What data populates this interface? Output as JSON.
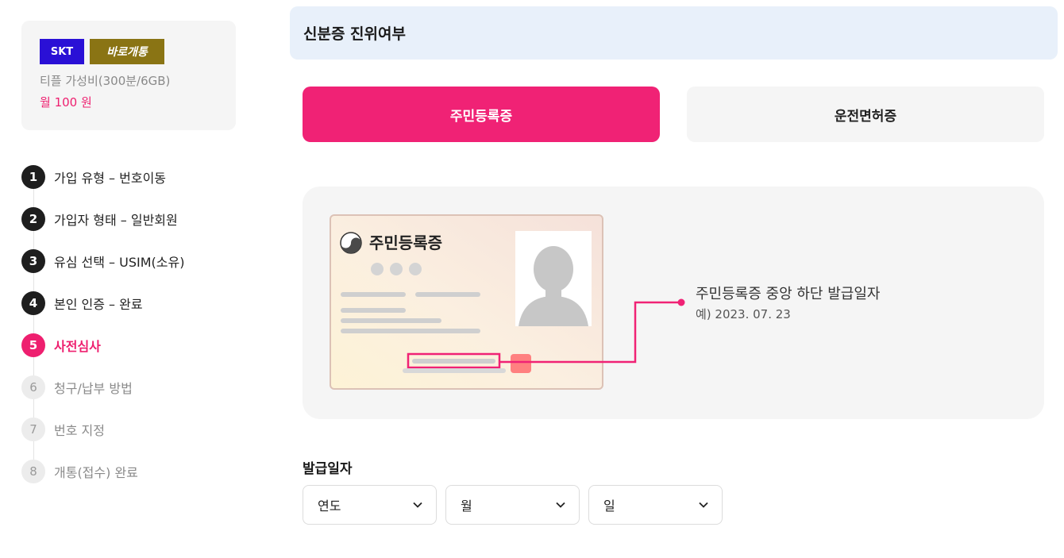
{
  "plan": {
    "carrier": "SKT",
    "tag": "바로개통",
    "name": "티플 가성비(300분/6GB)",
    "price": "월 100 원"
  },
  "steps": [
    {
      "num": "1",
      "label": "가입 유형 – 번호이동",
      "state": "done"
    },
    {
      "num": "2",
      "label": "가입자 형태 – 일반회원",
      "state": "done"
    },
    {
      "num": "3",
      "label": "유심 선택 – USIM(소유)",
      "state": "done"
    },
    {
      "num": "4",
      "label": "본인 인증 – 완료",
      "state": "done"
    },
    {
      "num": "5",
      "label": "사전심사",
      "state": "active"
    },
    {
      "num": "6",
      "label": "청구/납부 방법",
      "state": "future"
    },
    {
      "num": "7",
      "label": "번호 지정",
      "state": "future"
    },
    {
      "num": "8",
      "label": "개통(접수) 완료",
      "state": "future"
    }
  ],
  "section_title": "신분증 진위여부",
  "tabs": {
    "resident_card": "주민등록증",
    "driver_license": "운전면허증"
  },
  "illustration": {
    "card_title": "주민등록증",
    "guide_title": "주민등록증 중앙 하단 발급일자",
    "guide_example": "예) 2023. 07. 23"
  },
  "issue_date": {
    "label": "발급일자",
    "year_placeholder": "연도",
    "month_placeholder": "월",
    "day_placeholder": "일"
  },
  "colors": {
    "accent": "#f02275",
    "carrier_badge": "#2a10d6",
    "tag_badge": "#8a7414",
    "header_bg": "#e8f0fa"
  }
}
